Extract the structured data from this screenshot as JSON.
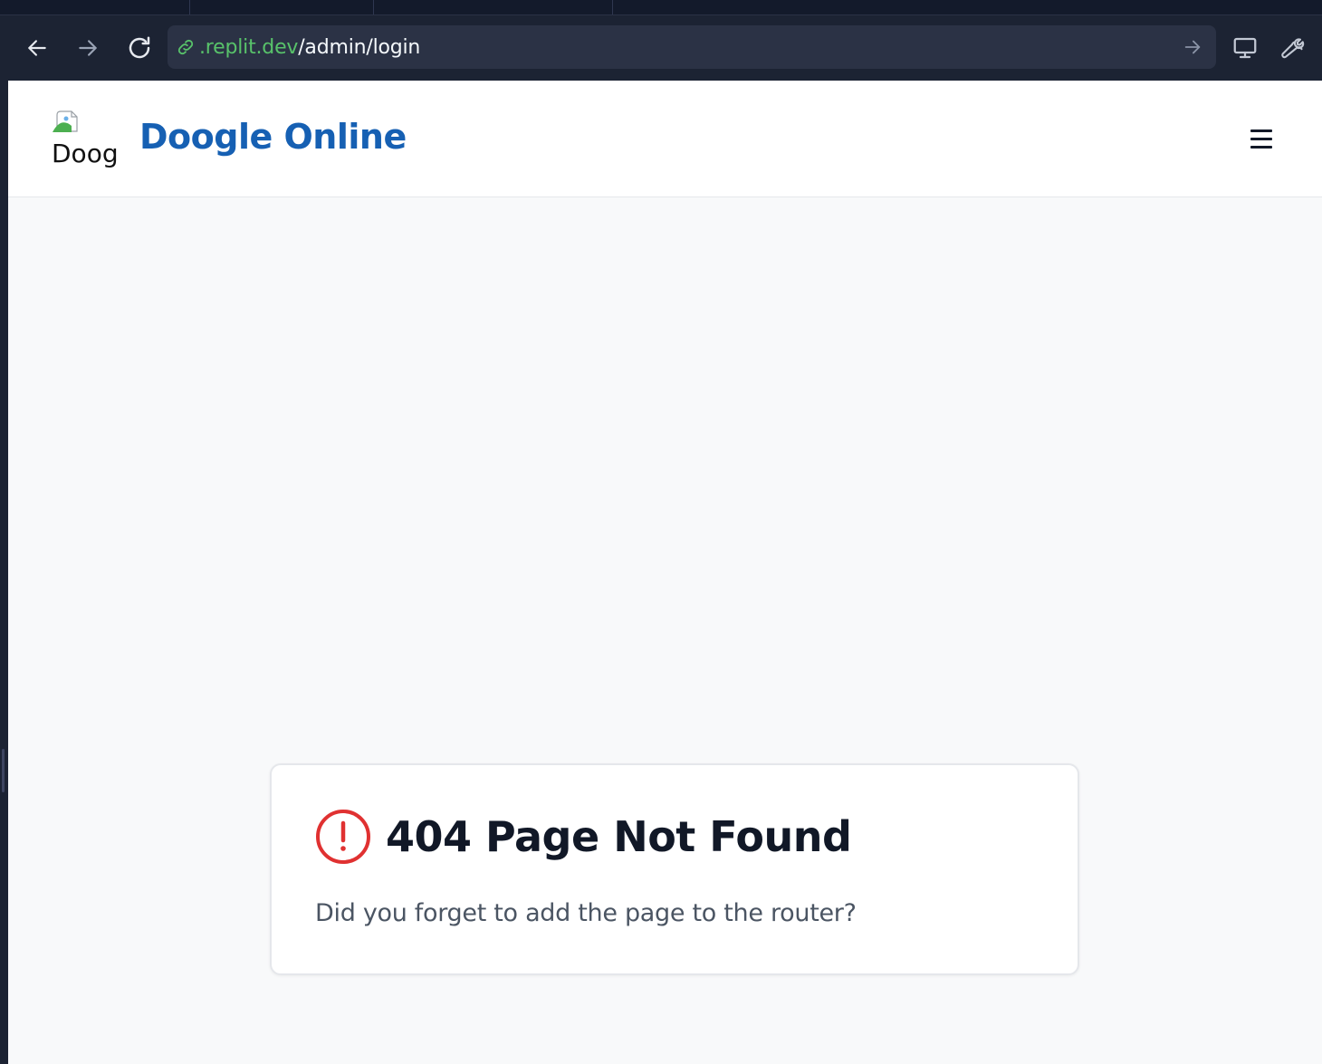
{
  "browser": {
    "url_domain": ".replit.dev",
    "url_path": "/admin/login"
  },
  "site": {
    "logo_alt": "Doog",
    "brand_name": "Doogle Online"
  },
  "error_card": {
    "title": "404 Page Not Found",
    "message": "Did you forget to add the page to the router?"
  },
  "colors": {
    "brand": "#1660b3",
    "error": "#e03131",
    "url_domain": "#58c26a"
  }
}
